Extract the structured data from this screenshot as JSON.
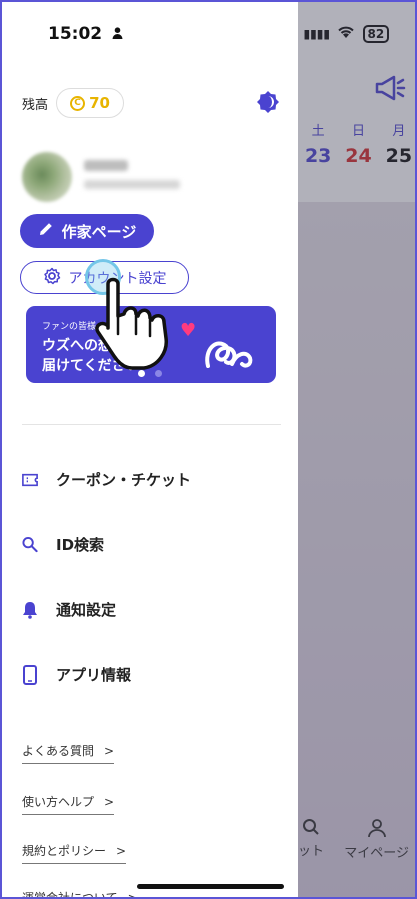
{
  "status_bar": {
    "time": "15:02",
    "person_glyph": "▲",
    "battery": "82"
  },
  "drawer": {
    "balance_label": "残高",
    "coin_symbol": "C",
    "coin_amount": "70",
    "buttons": {
      "creator_page": "作家ページ",
      "account_settings": "アカウント設定"
    },
    "banner": {
      "small_text": "ファンの皆様",
      "line1": "ウズへの想",
      "line2": "届けてください",
      "active_slide": 1,
      "slides": 2
    },
    "menu": [
      {
        "label": "クーポン・チケット",
        "icon": "ticket-icon"
      },
      {
        "label": "ID検索",
        "icon": "search-icon"
      },
      {
        "label": "通知設定",
        "icon": "bell-icon"
      },
      {
        "label": "アプリ情報",
        "icon": "phone-icon"
      }
    ],
    "links": [
      {
        "label": "よくある質問"
      },
      {
        "label": "使い方ヘルプ"
      },
      {
        "label": "規約とポリシー"
      },
      {
        "label": "運営会社について"
      }
    ]
  },
  "background_app": {
    "calendar": [
      {
        "dow": "土",
        "day": "23"
      },
      {
        "dow": "日",
        "day": "24"
      },
      {
        "dow": "月",
        "day": "25"
      }
    ],
    "nav": [
      {
        "label": "ット"
      },
      {
        "label": "マイページ"
      }
    ]
  },
  "colors": {
    "accent": "#4a43d0",
    "coin": "#e8b400",
    "sunday": "#d62a2a",
    "overlay": "#8a88a3"
  }
}
